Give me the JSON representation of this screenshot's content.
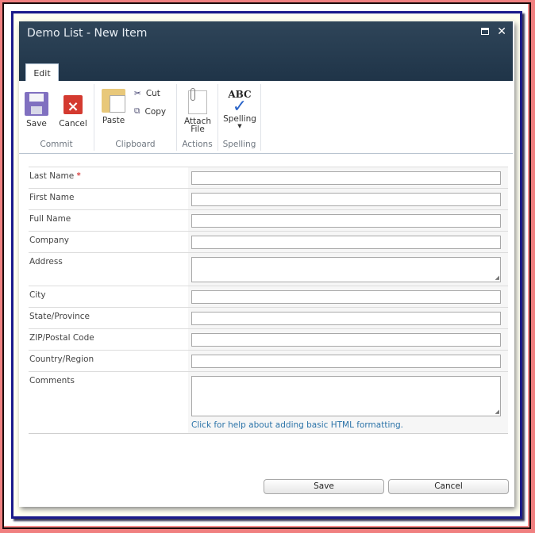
{
  "dialog": {
    "title": "Demo List - New Item",
    "maximize_icon": "maximize-icon",
    "close_icon": "close-icon"
  },
  "ribbon": {
    "tabs": [
      {
        "label": "Edit",
        "selected": true
      }
    ],
    "groups": {
      "commit": {
        "label": "Commit",
        "save": "Save",
        "cancel": "Cancel"
      },
      "clipboard": {
        "label": "Clipboard",
        "paste": "Paste",
        "cut": "Cut",
        "copy": "Copy"
      },
      "actions": {
        "label": "Actions",
        "attach_line1": "Attach",
        "attach_line2": "File"
      },
      "spelling": {
        "label": "Spelling",
        "spelling": "Spelling",
        "abc": "ABC"
      }
    }
  },
  "form": {
    "required_marker": "*",
    "fields": [
      {
        "label": "Last Name",
        "required": true,
        "value": ""
      },
      {
        "label": "First Name",
        "value": ""
      },
      {
        "label": "Full Name",
        "value": ""
      },
      {
        "label": "Company",
        "value": ""
      },
      {
        "label": "Address",
        "value": ""
      },
      {
        "label": "City",
        "value": ""
      },
      {
        "label": "State/Province",
        "value": ""
      },
      {
        "label": "ZIP/Postal Code",
        "value": ""
      },
      {
        "label": "Country/Region",
        "value": ""
      },
      {
        "label": "Comments",
        "value": ""
      }
    ],
    "help_link": "Click for help about adding basic HTML formatting."
  },
  "footer": {
    "save": "Save",
    "cancel": "Cancel"
  }
}
